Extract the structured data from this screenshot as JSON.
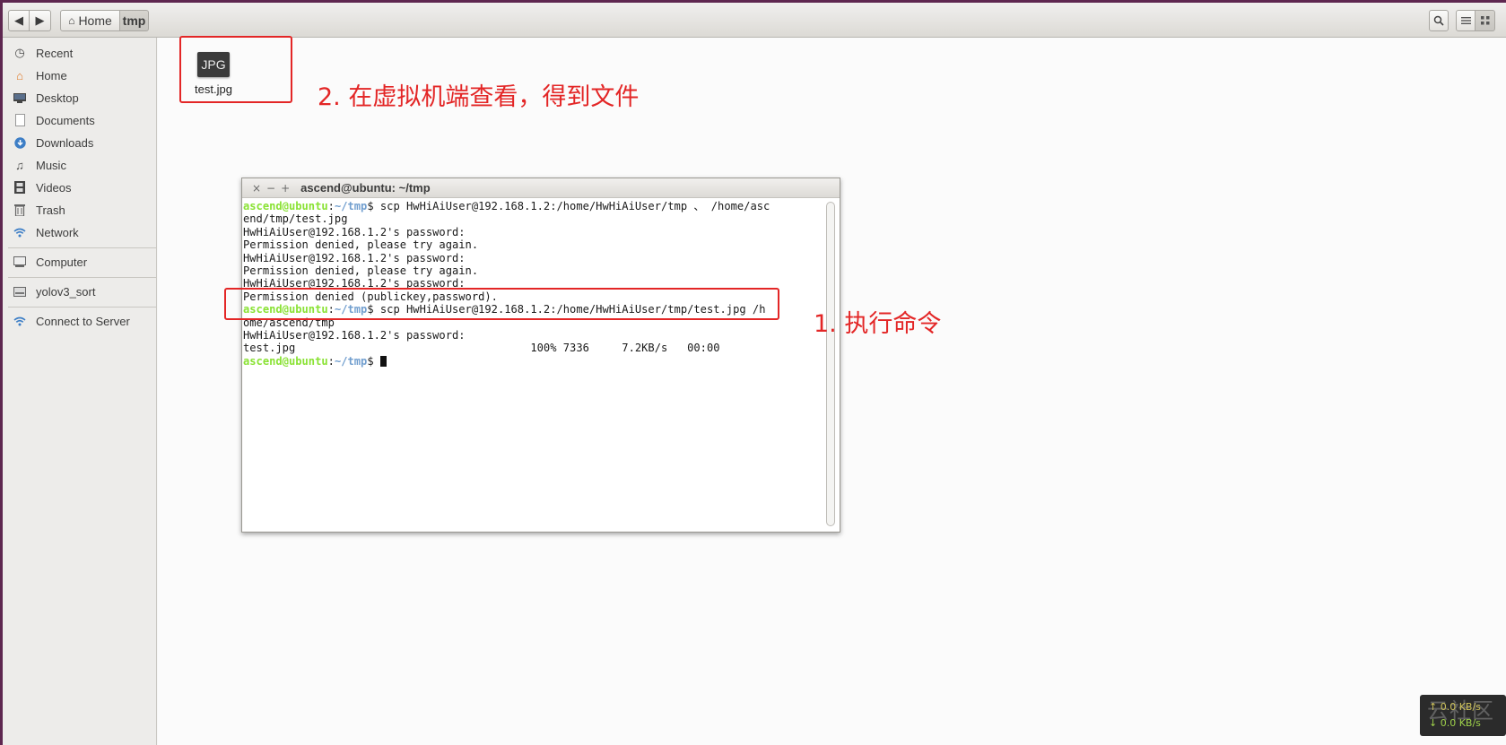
{
  "toolbar": {
    "breadcrumb_home": "Home",
    "breadcrumb_current": "tmp"
  },
  "sidebar": {
    "items": [
      {
        "label": "Recent",
        "icon": "clock-icon"
      },
      {
        "label": "Home",
        "icon": "home-icon"
      },
      {
        "label": "Desktop",
        "icon": "desktop-icon"
      },
      {
        "label": "Documents",
        "icon": "document-icon"
      },
      {
        "label": "Downloads",
        "icon": "download-icon"
      },
      {
        "label": "Music",
        "icon": "music-icon"
      },
      {
        "label": "Videos",
        "icon": "video-icon"
      },
      {
        "label": "Trash",
        "icon": "trash-icon"
      },
      {
        "label": "Network",
        "icon": "network-icon"
      },
      {
        "label": "Computer",
        "icon": "computer-icon"
      },
      {
        "label": "yolov3_sort",
        "icon": "drive-icon"
      },
      {
        "label": "Connect to Server",
        "icon": "network-icon"
      }
    ]
  },
  "file": {
    "icon_text": "JPG",
    "name": "test.jpg"
  },
  "annotations": {
    "step2": "2. 在虚拟机端查看，得到文件",
    "step1": "1. 执行命令"
  },
  "terminal": {
    "title": "ascend@ubuntu: ~/tmp",
    "prompt_user": "ascend@ubuntu",
    "prompt_sep": ":",
    "prompt_path": "~/tmp",
    "prompt_end": "$ ",
    "cmd1_part1": "scp HwHiAiUser@192.168.1.2:/home/HwHiAiUser/tmp 、 /home/asc",
    "cmd1_part2": "end/tmp/test.jpg",
    "pw_prompt": "HwHiAiUser@192.168.1.2's password:",
    "denied": "Permission denied, please try again.",
    "denied_final": "Permission denied (publickey,password).",
    "cmd2_part1": "scp HwHiAiUser@192.168.1.2:/home/HwHiAiUser/tmp/test.jpg /h",
    "cmd2_part2": "ome/ascend/tmp",
    "transfer": "test.jpg                                    100% 7336     7.2KB/s   00:00"
  },
  "speed": {
    "up": "↑ 0.0 KB/s",
    "down": "↓ 0.0 KB/s",
    "watermark": "云社区"
  },
  "colors": {
    "annotation_red": "#e32626",
    "prompt_green": "#8ae234",
    "prompt_blue": "#729fcf"
  }
}
